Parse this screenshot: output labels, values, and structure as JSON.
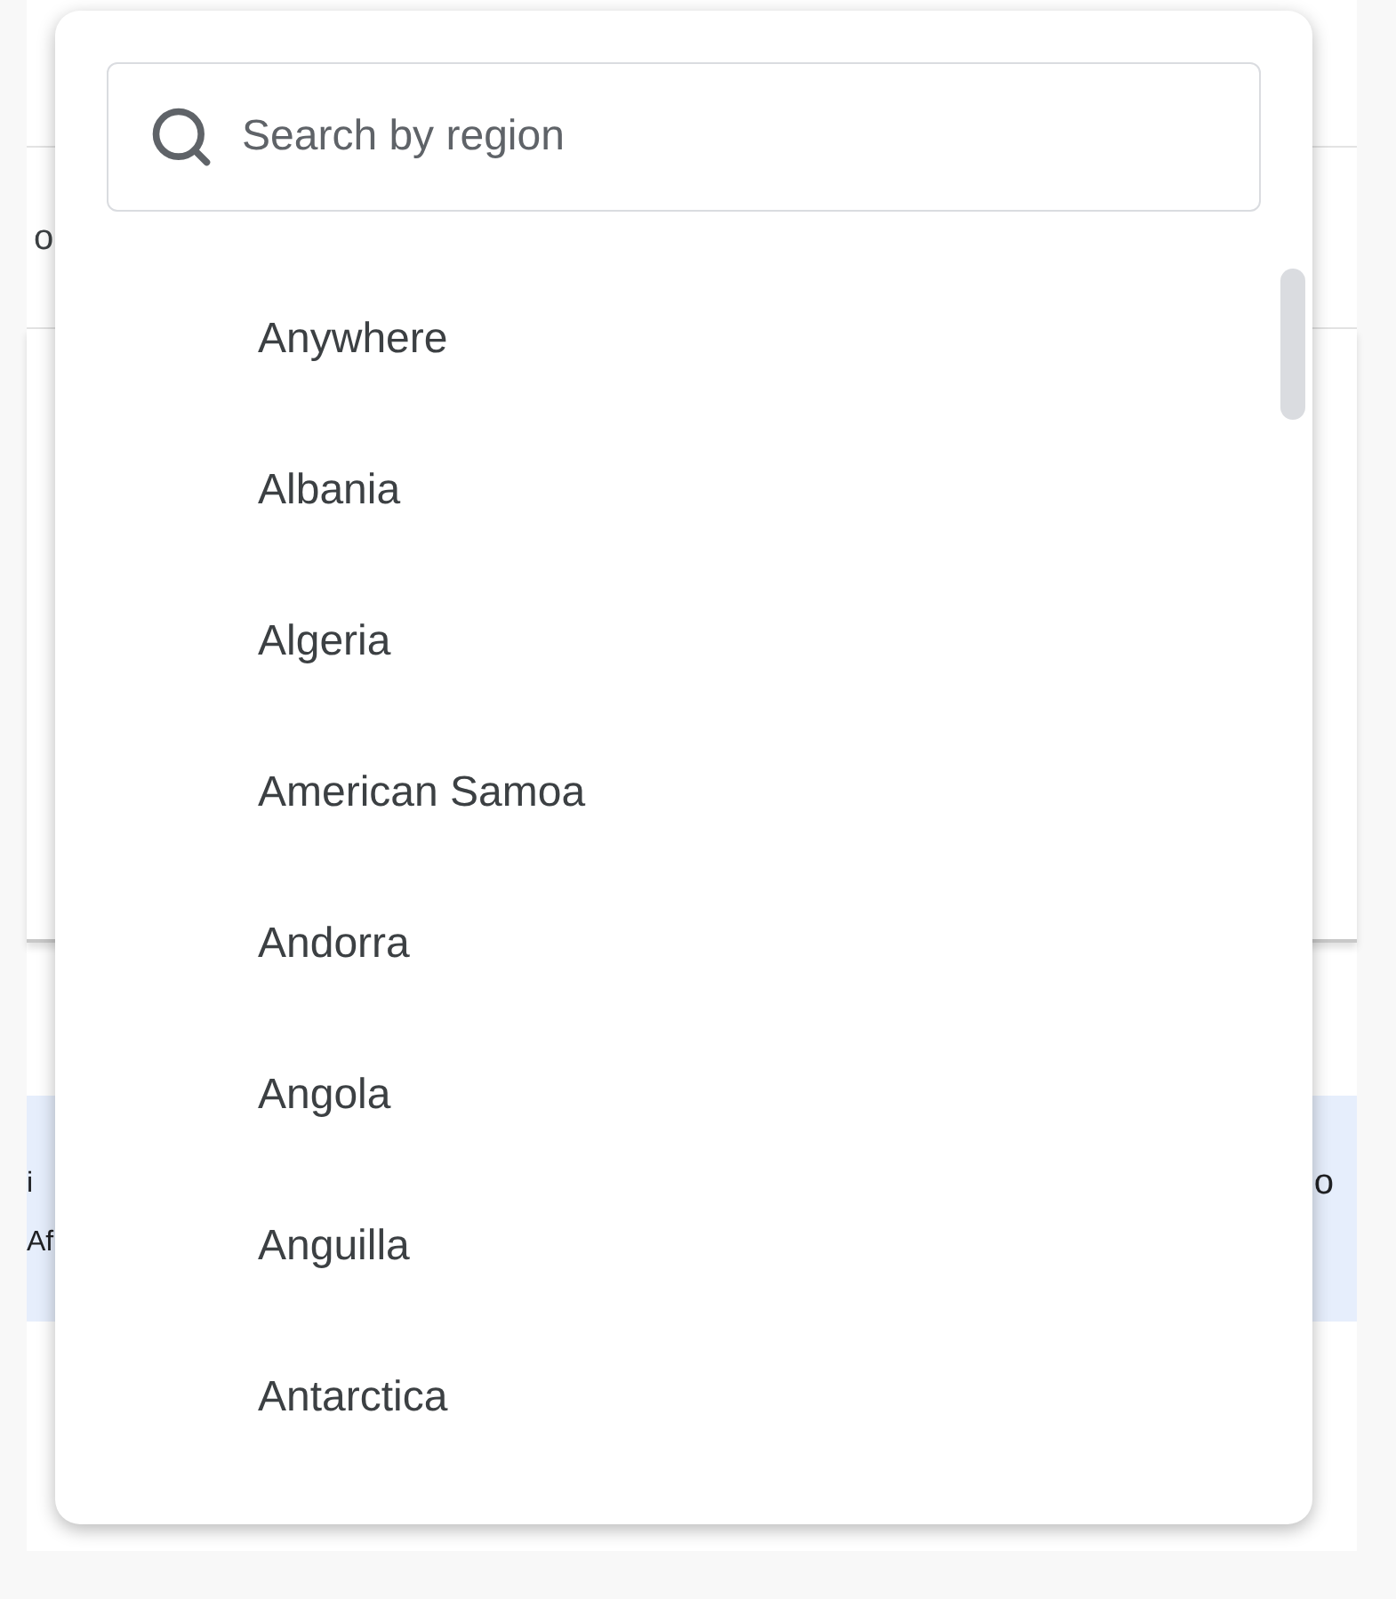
{
  "page": {
    "row_text": "o",
    "band": {
      "left_lines": [
        "i",
        "Af"
      ],
      "right_text": "o"
    }
  },
  "region_menu": {
    "search": {
      "placeholder": "Search by region"
    },
    "options": [
      {
        "label": "Anywhere"
      },
      {
        "label": "Albania"
      },
      {
        "label": "Algeria"
      },
      {
        "label": "American Samoa"
      },
      {
        "label": "Andorra"
      },
      {
        "label": "Angola"
      },
      {
        "label": "Anguilla"
      },
      {
        "label": "Antarctica"
      }
    ]
  }
}
